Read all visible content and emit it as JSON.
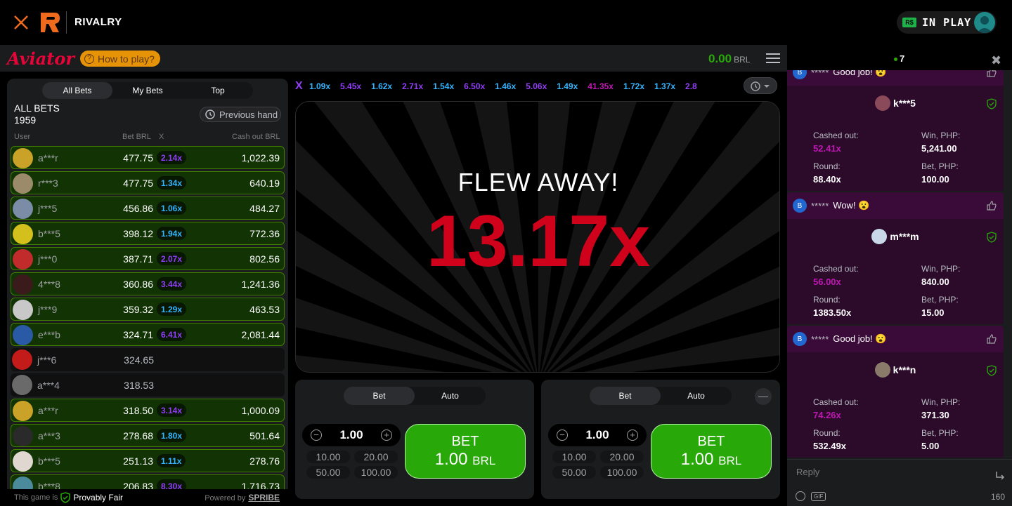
{
  "topbar": {
    "brand": "RIVALRY",
    "currency_badge": "R$",
    "in_play_label": "IN PLAY"
  },
  "game_header": {
    "logo": "Aviator",
    "how_to_play": "How to play?",
    "balance": "0.00",
    "currency": "BRL"
  },
  "bets_panel": {
    "tabs": [
      "All Bets",
      "My Bets",
      "Top"
    ],
    "active_tab": "All Bets",
    "title": "ALL BETS",
    "count": "1959",
    "previous_hand": "Previous hand",
    "columns": {
      "user": "User",
      "bet": "Bet BRL",
      "x": "X",
      "cashout": "Cash out BRL"
    },
    "rows": [
      {
        "user": "a***r",
        "bet": "477.75",
        "mult": "2.14x",
        "cashout": "1,022.39",
        "won": true,
        "mult_color": "#913ef8"
      },
      {
        "user": "r***3",
        "bet": "477.75",
        "mult": "1.34x",
        "cashout": "640.19",
        "won": true,
        "mult_color": "#34b4ff"
      },
      {
        "user": "j***5",
        "bet": "456.86",
        "mult": "1.06x",
        "cashout": "484.27",
        "won": true,
        "mult_color": "#34b4ff"
      },
      {
        "user": "b***5",
        "bet": "398.12",
        "mult": "1.94x",
        "cashout": "772.36",
        "won": true,
        "mult_color": "#34b4ff"
      },
      {
        "user": "j***0",
        "bet": "387.71",
        "mult": "2.07x",
        "cashout": "802.56",
        "won": true,
        "mult_color": "#913ef8"
      },
      {
        "user": "4***8",
        "bet": "360.86",
        "mult": "3.44x",
        "cashout": "1,241.36",
        "won": true,
        "mult_color": "#913ef8"
      },
      {
        "user": "j***9",
        "bet": "359.32",
        "mult": "1.29x",
        "cashout": "463.53",
        "won": true,
        "mult_color": "#34b4ff"
      },
      {
        "user": "e***b",
        "bet": "324.71",
        "mult": "6.41x",
        "cashout": "2,081.44",
        "won": true,
        "mult_color": "#913ef8"
      },
      {
        "user": "j***6",
        "bet": "324.65",
        "mult": "",
        "cashout": "",
        "won": false,
        "mult_color": "#913ef8"
      },
      {
        "user": "a***4",
        "bet": "318.53",
        "mult": "",
        "cashout": "",
        "won": false,
        "mult_color": "#913ef8"
      },
      {
        "user": "a***r",
        "bet": "318.50",
        "mult": "3.14x",
        "cashout": "1,000.09",
        "won": true,
        "mult_color": "#913ef8"
      },
      {
        "user": "a***3",
        "bet": "278.68",
        "mult": "1.80x",
        "cashout": "501.64",
        "won": true,
        "mult_color": "#34b4ff"
      },
      {
        "user": "b***5",
        "bet": "251.13",
        "mult": "1.11x",
        "cashout": "278.76",
        "won": true,
        "mult_color": "#34b4ff"
      },
      {
        "user": "b***8",
        "bet": "206.83",
        "mult": "8.30x",
        "cashout": "1,716.73",
        "won": true,
        "mult_color": "#913ef8"
      }
    ],
    "footer_prefix": "This game is",
    "provably_fair": "Provably Fair",
    "powered_by": "Powered by",
    "provider": "SPRIBE"
  },
  "history": [
    {
      "v": "1.09x",
      "c": "#34b4ff"
    },
    {
      "v": "5.45x",
      "c": "#913ef8"
    },
    {
      "v": "1.62x",
      "c": "#34b4ff"
    },
    {
      "v": "2.71x",
      "c": "#913ef8"
    },
    {
      "v": "1.54x",
      "c": "#34b4ff"
    },
    {
      "v": "6.50x",
      "c": "#913ef8"
    },
    {
      "v": "1.46x",
      "c": "#34b4ff"
    },
    {
      "v": "5.06x",
      "c": "#913ef8"
    },
    {
      "v": "1.49x",
      "c": "#34b4ff"
    },
    {
      "v": "41.35x",
      "c": "#c017b4"
    },
    {
      "v": "1.72x",
      "c": "#34b4ff"
    },
    {
      "v": "1.37x",
      "c": "#34b4ff"
    },
    {
      "v": "2.8",
      "c": "#913ef8"
    }
  ],
  "stage": {
    "flew_away": "FLEW AWAY!",
    "crash_multiplier": "13.17x"
  },
  "bet_panels": [
    {
      "tabs": [
        "Bet",
        "Auto"
      ],
      "amount": "1.00",
      "quick": [
        "10.00",
        "20.00",
        "50.00",
        "100.00"
      ],
      "bet_label": "BET",
      "bet_amount": "1.00",
      "bet_currency": "BRL"
    },
    {
      "tabs": [
        "Bet",
        "Auto"
      ],
      "amount": "1.00",
      "quick": [
        "10.00",
        "20.00",
        "50.00",
        "100.00"
      ],
      "bet_label": "BET",
      "bet_amount": "1.00",
      "bet_currency": "BRL"
    }
  ],
  "chat": {
    "online_count": "7",
    "messages": [
      {
        "badge": "B",
        "stars": "*****",
        "text": "Good job! 😮",
        "user": "k***5",
        "cashed_label": "Cashed out:",
        "cashed": "52.41x",
        "win_label": "Win, PHP:",
        "win": "5,241.00",
        "round_label": "Round:",
        "round": "88.40x",
        "bet_label": "Bet, PHP:",
        "bet": "100.00"
      },
      {
        "badge": "B",
        "stars": "*****",
        "text": "Wow! 😮",
        "user": "m***m",
        "cashed_label": "Cashed out:",
        "cashed": "56.00x",
        "win_label": "Win, PHP:",
        "win": "840.00",
        "round_label": "Round:",
        "round": "1383.50x",
        "bet_label": "Bet, PHP:",
        "bet": "15.00"
      },
      {
        "badge": "B",
        "stars": "*****",
        "text": "Good job! 😮",
        "user": "k***n",
        "cashed_label": "Cashed out:",
        "cashed": "74.26x",
        "win_label": "Win, PHP:",
        "win": "371.30",
        "round_label": "Round:",
        "round": "532.49x",
        "bet_label": "Bet, PHP:",
        "bet": "5.00"
      }
    ],
    "reply_placeholder": "Reply",
    "gif_label": "GIF",
    "char_count": "160"
  }
}
